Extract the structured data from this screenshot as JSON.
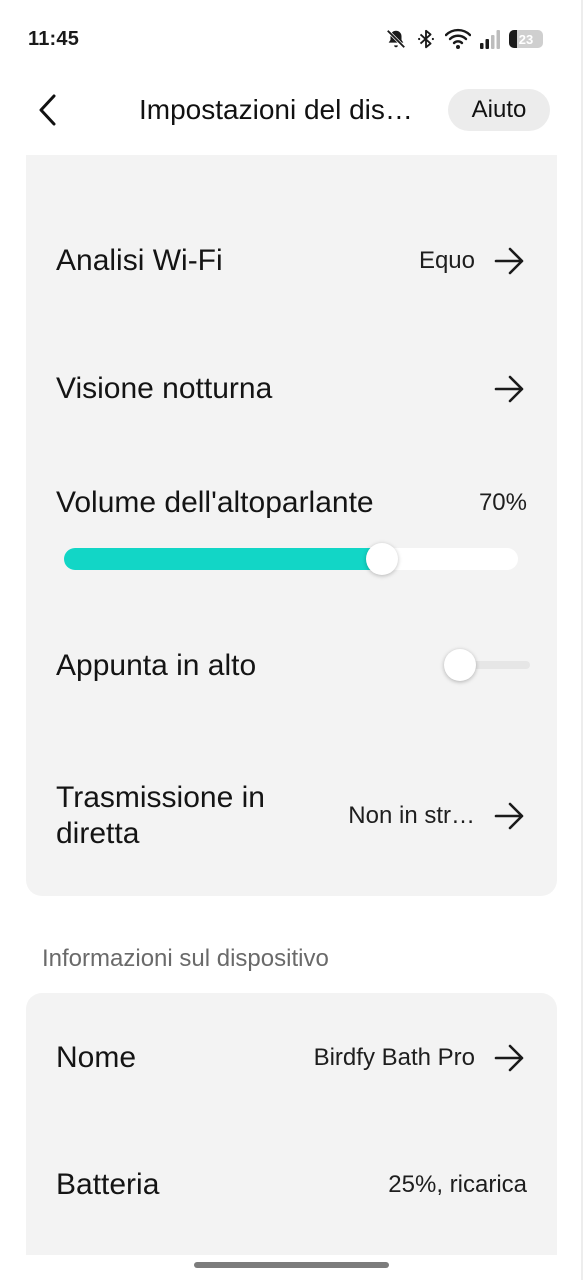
{
  "status_bar": {
    "time": "11:45",
    "battery_level": "23",
    "icons": [
      "bell-off-icon",
      "bluetooth-icon",
      "wifi-icon",
      "signal-icon",
      "battery-icon"
    ]
  },
  "header": {
    "back_icon": "chevron-left-icon",
    "title": "Impostazioni del dis…",
    "help_label": "Aiuto"
  },
  "settings": {
    "wifi_analysis": {
      "label": "Analisi Wi-Fi",
      "value": "Equo"
    },
    "night_vision": {
      "label": "Visione notturna"
    },
    "speaker_volume": {
      "label": "Volume dell'altoparlante",
      "value_text": "70%",
      "value": 0.7
    },
    "pin_top": {
      "label": "Appunta in alto",
      "enabled": false
    },
    "live_stream": {
      "label": "Trasmissione in diretta",
      "value": "Non in str…"
    }
  },
  "device_info": {
    "section_title": "Informazioni sul dispositivo",
    "name": {
      "label": "Nome",
      "value": "Birdfy Bath Pro"
    },
    "battery": {
      "label": "Batteria",
      "value": "25%, ricarica"
    }
  },
  "colors": {
    "accent": "#12d6c6",
    "card_bg": "#f3f3f3",
    "page_bg": "#ffffff",
    "secondary_text": "#6a6a6a"
  }
}
